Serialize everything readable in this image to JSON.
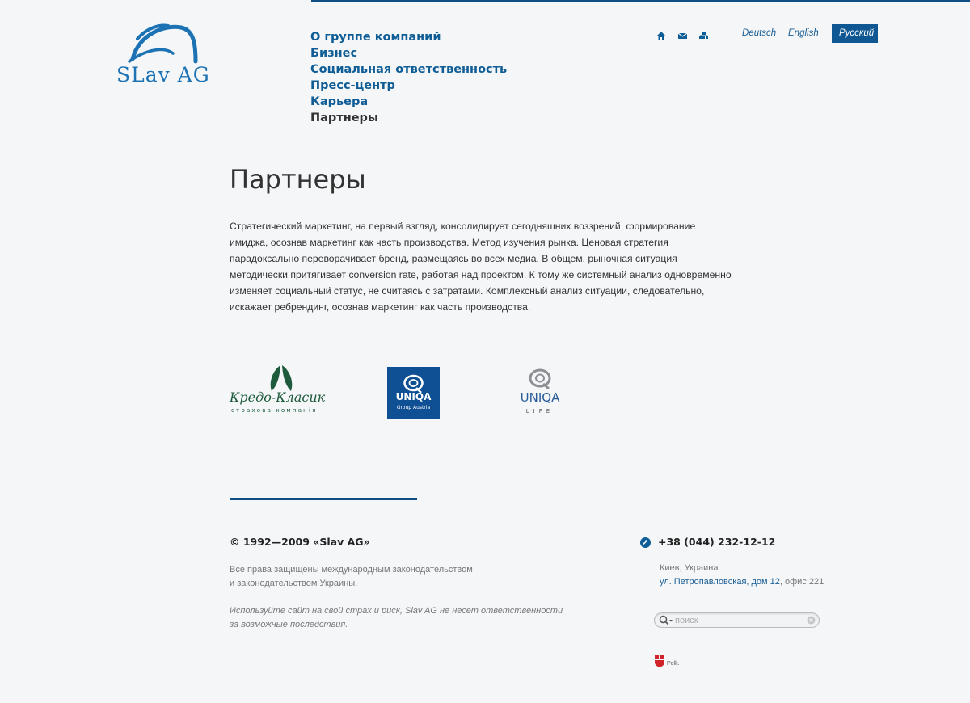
{
  "brand": {
    "logo_text": "SLav AG",
    "accent_color": "#0f5793"
  },
  "nav": {
    "items": [
      {
        "label": "О группе компаний",
        "active": false
      },
      {
        "label": "Бизнес",
        "active": false
      },
      {
        "label": "Социальная ответственность",
        "active": false
      },
      {
        "label": "Пресс-центр",
        "active": false
      },
      {
        "label": "Карьера",
        "active": false
      },
      {
        "label": "Партнеры",
        "active": true
      }
    ]
  },
  "utility_icons": [
    "home-icon",
    "mail-icon",
    "sitemap-icon"
  ],
  "languages": [
    {
      "label": "Deutsch",
      "active": false
    },
    {
      "label": "English",
      "active": false
    },
    {
      "label": "Русский",
      "active": true
    }
  ],
  "page": {
    "title": "Партнеры",
    "intro": "Стратегический маркетинг, на первый взгляд, консолидирует сегодняшних воззрений, формирование имиджа, осознав маркетинг как часть производства. Метод изучения рынка. Ценовая стратегия парадоксально переворачивает бренд, размещаясь во всех медиа. В общем, рыночная ситуация методически притягивает conversion rate, работая над проектом. К тому же системный анализ одновременно изменяет социальный статус, не считаясь с затратами. Комплексный анализ ситуации, следовательно, искажает ребрендинг, осознав маркетинг как часть производства."
  },
  "partners": [
    {
      "name": "Кредо-Класик",
      "subtitle": "страхова компанія"
    },
    {
      "name": "UNIQA",
      "subtitle": "Group Austria"
    },
    {
      "name": "UNIQA",
      "subtitle": "LIFE"
    }
  ],
  "footer": {
    "copyright": "© 1992—2009 «Slav AG»",
    "rights_line1": "Все права защищены международным законодательством",
    "rights_line2": "и законодательством Украины.",
    "disclaimer_line1": "Используйте сайт на свой страх и риск, Slav AG не несет ответственности",
    "disclaimer_line2": "за возможные последствия.",
    "phone": "+38 (044) 232-12-12",
    "city": "Киев, Украина",
    "address_link": "ул. Петропавловская, дом 12",
    "address_rest": ", офис 221",
    "search_placeholder": "поиск",
    "badge_text": "Polk."
  }
}
